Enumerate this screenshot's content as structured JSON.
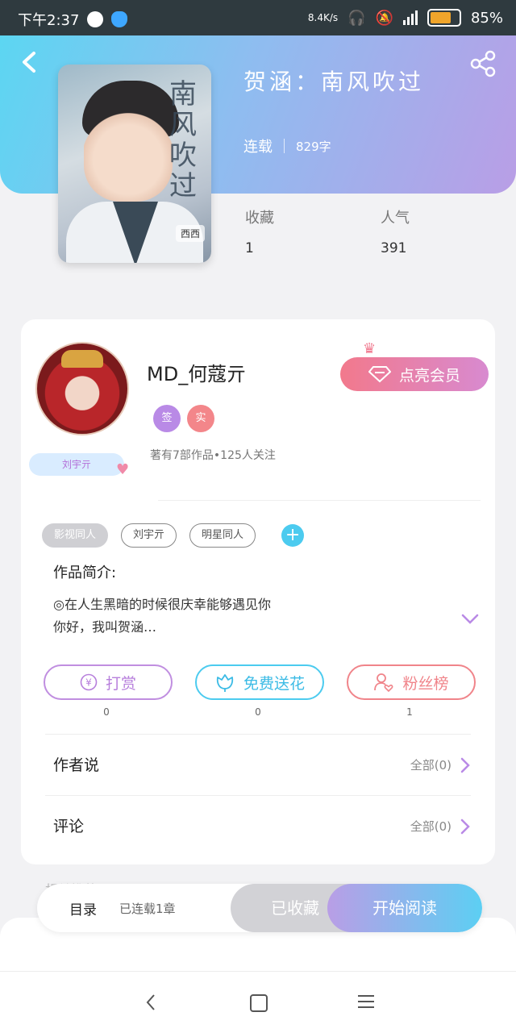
{
  "status_bar": {
    "time": "下午2:37",
    "net_speed": "8.4K/s",
    "battery": "85%",
    "battery_level": 0.85
  },
  "book": {
    "title": "贺涵：南风吹过",
    "status": "连载",
    "word_count": "829字",
    "cover_title": "南风吹过",
    "cover_tag": "西西"
  },
  "stats": {
    "favorites_label": "收藏",
    "favorites_value": "1",
    "popularity_label": "人气",
    "popularity_value": "391"
  },
  "author": {
    "name": "MD_何蔻亓",
    "badge_sign": "签",
    "badge_real": "实",
    "avatar_name_tag": "刘宇亓",
    "stats_line": "著有7部作品•125人关注",
    "vip_button": "点亮会员"
  },
  "tags": [
    "影视同人",
    "刘宇亓",
    "明星同人"
  ],
  "intro": {
    "label": "作品简介:",
    "text": "◎在人生黑暗的时候很庆幸能够遇见你\n你好，我叫贺涵…"
  },
  "actions": [
    {
      "label": "打赏",
      "count": "0"
    },
    {
      "label": "免费送花",
      "count": "0"
    },
    {
      "label": "粉丝榜",
      "count": "1"
    }
  ],
  "rows": {
    "author_says": {
      "label": "作者说",
      "right": "全部(0)"
    },
    "comments": {
      "label": "评论",
      "right": "全部(0)"
    }
  },
  "bottom_bar": {
    "toc": "目录",
    "serial": "已连载1章",
    "favorited": "已收藏",
    "start_reading": "开始阅读",
    "faded_text": "相关推荐"
  },
  "colors": {
    "accent_cyan": "#5cd6f2",
    "accent_purple": "#b99ee6",
    "pink": "#f0848a"
  }
}
